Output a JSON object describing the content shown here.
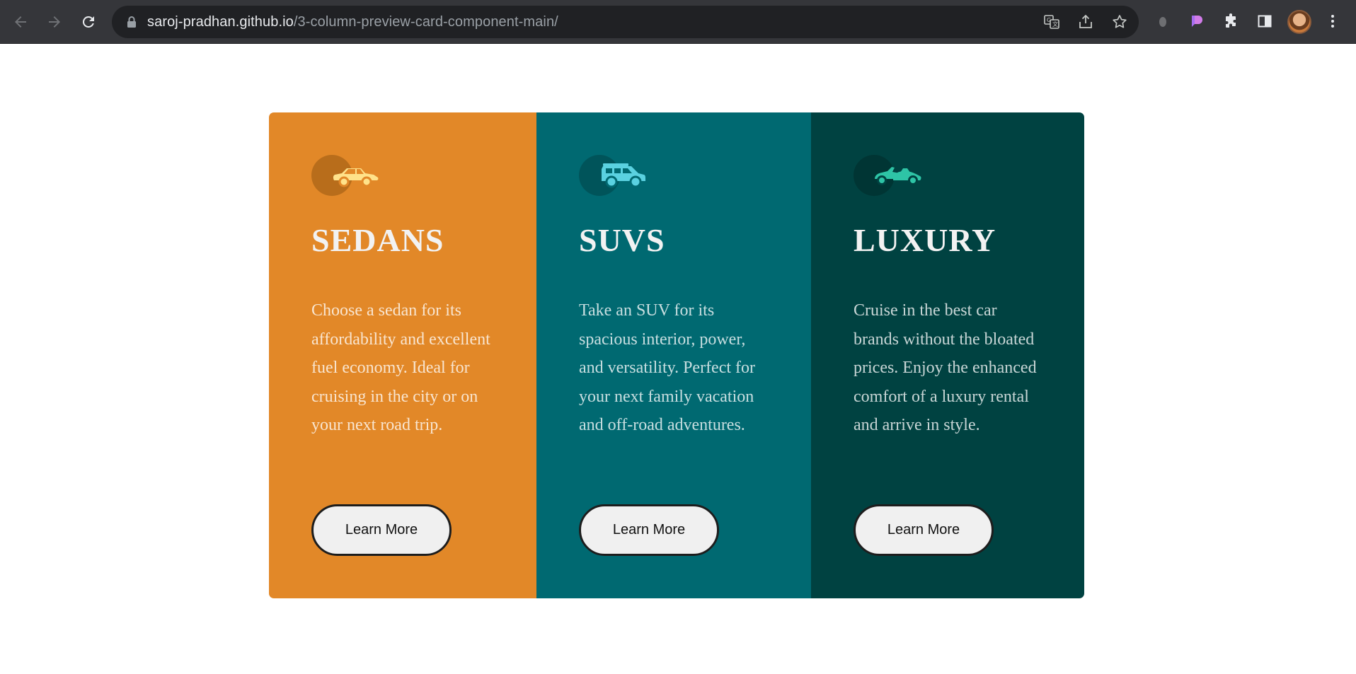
{
  "browser": {
    "url_host": "saroj-pradhan.github.io",
    "url_path": "/3-column-preview-card-component-main/",
    "icons": [
      "back-icon",
      "forward-icon",
      "reload-icon",
      "lock-icon",
      "translate-icon",
      "share-icon",
      "bookmark-star-icon",
      "extension-icon",
      "extension-icon",
      "puzzle-icon",
      "side-panel-icon",
      "avatar",
      "menu-icon"
    ]
  },
  "colors": {
    "sedans_bg": "#e28828",
    "suvs_bg": "#006971",
    "luxury_bg": "#004241",
    "button_bg": "#f0f0f0"
  },
  "cards": [
    {
      "title": "SEDANS",
      "text": "Choose a sedan for its affordability and excellent fuel economy. Ideal for cruising in the city or on your next road trip.",
      "button": "Learn More",
      "icon": "sedan-icon"
    },
    {
      "title": "SUVS",
      "text": "Take an SUV for its spacious interior, power, and versatility. Perfect for your next family vacation and off-road adventures.",
      "button": "Learn More",
      "icon": "suv-icon"
    },
    {
      "title": "LUXURY",
      "text": "Cruise in the best car brands without the bloated prices. Enjoy the enhanced comfort of a luxury rental and arrive in style.",
      "button": "Learn More",
      "icon": "luxury-car-icon"
    }
  ]
}
